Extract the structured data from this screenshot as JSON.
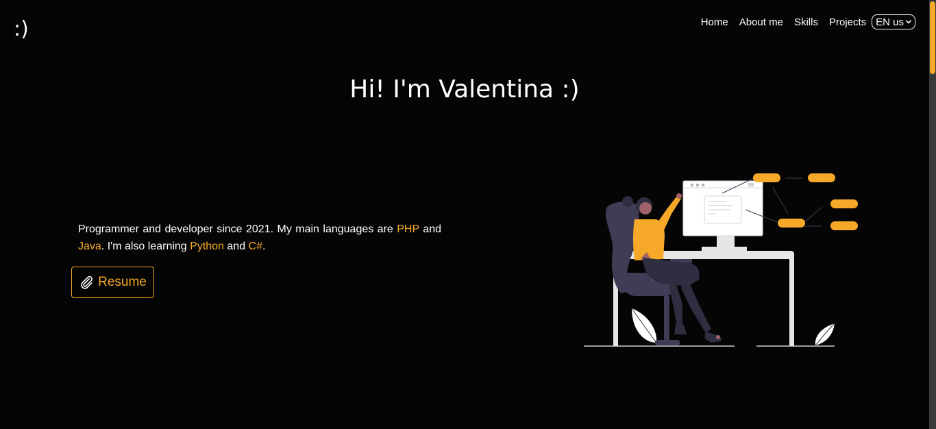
{
  "header": {
    "logo": ":)",
    "nav": {
      "home": "Home",
      "about": "About me",
      "skills": "Skills",
      "projects": "Projects"
    },
    "language": {
      "selected": "EN us"
    }
  },
  "hero": {
    "title": "Hi! I'm Valentina :)",
    "intro": {
      "part1": "Programmer and developer since 2021. My main languages are ",
      "lang1": "PHP",
      "part2": " and ",
      "lang2": "Java",
      "part3": ". I'm also learning ",
      "lang3": "Python",
      "part4": " and ",
      "lang4": "C#",
      "part5": "."
    },
    "resume_label": "Resume",
    "resume_icon": "paperclip-icon"
  },
  "illustration": {
    "name": "developer-at-desk-illustration"
  },
  "colors": {
    "background": "#050505",
    "accent": "#f6a928",
    "text": "#ffffff",
    "figure": "#3f3d56"
  }
}
